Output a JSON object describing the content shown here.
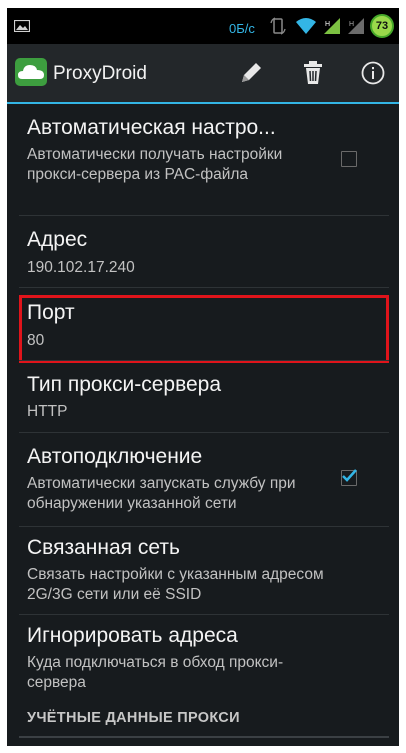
{
  "status_bar": {
    "speed": "0Б/с",
    "battery": "73",
    "icons": [
      "picture-icon",
      "rotate-icon",
      "wifi-icon",
      "signal-icon",
      "signal-icon-2",
      "battery-icon"
    ]
  },
  "action_bar": {
    "app_title": "ProxyDroid",
    "actions": [
      "edit-icon",
      "delete-icon",
      "info-icon"
    ]
  },
  "preferences": [
    {
      "title": "Автоматическая настро...",
      "summary": "Автоматически получать настройки прокси-сервера из PAC-файла",
      "checkbox": false
    },
    {
      "title": "Адрес",
      "summary": "190.102.17.240"
    },
    {
      "title": "Порт",
      "summary": "80"
    },
    {
      "title": "Тип прокси-сервера",
      "summary": "HTTP"
    },
    {
      "title": "Автоподключение",
      "summary": "Автоматически запускать службу при обнаружении указанной сети",
      "checkbox": true
    },
    {
      "title": "Связанная сеть",
      "summary": "Связать настройки с указанным адресом 2G/3G сети или её SSID"
    },
    {
      "title": "Игнорировать адреса",
      "summary": "Куда подключаться в обход прокси-сервера"
    }
  ],
  "section_header": "УЧЁТНЫЕ ДАННЫЕ ПРОКСИ",
  "colors": {
    "accent": "#33b5e5",
    "highlight": "#e0141b",
    "checkmark": "#33b5e5",
    "background": "#171b1e"
  }
}
